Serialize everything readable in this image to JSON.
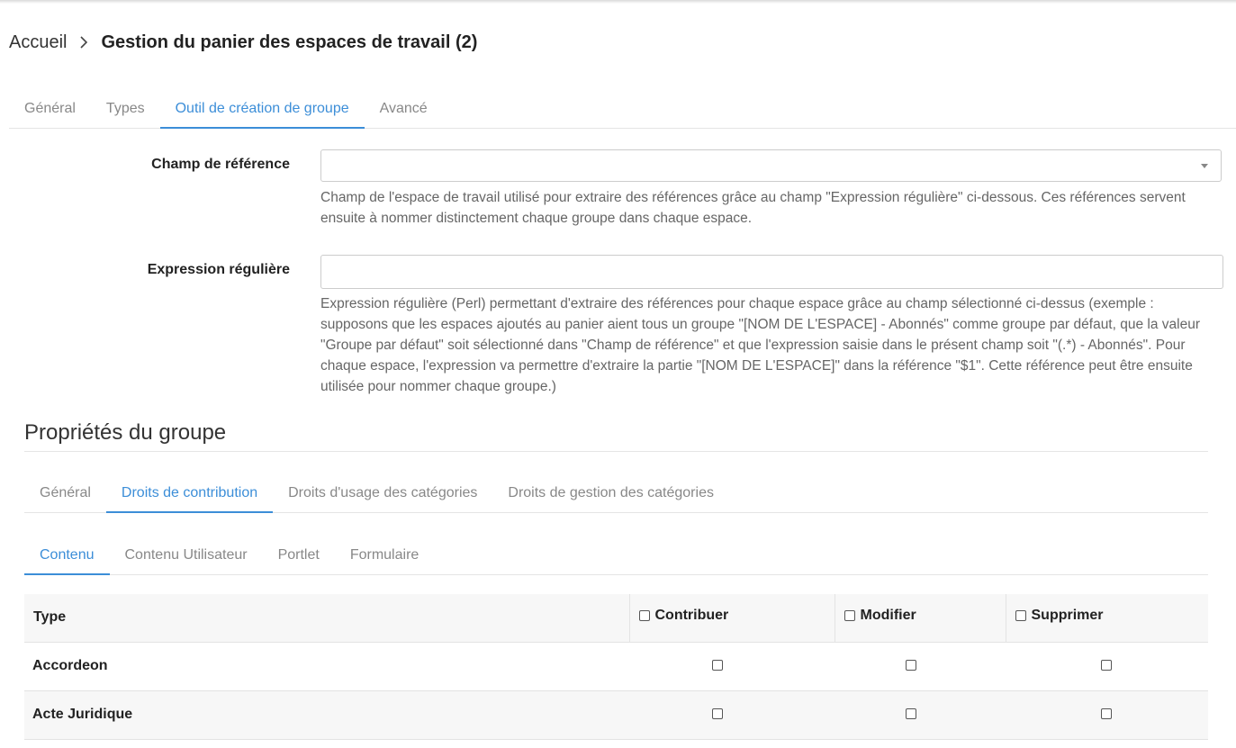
{
  "breadcrumb": {
    "home": "Accueil",
    "current": "Gestion du panier des espaces de travail (2)"
  },
  "main_tabs": [
    {
      "label": "Général",
      "active": false
    },
    {
      "label": "Types",
      "active": false
    },
    {
      "label": "Outil de création de groupe",
      "active": true
    },
    {
      "label": "Avancé",
      "active": false
    }
  ],
  "form": {
    "reference_field": {
      "label": "Champ de référence",
      "value": "",
      "help": "Champ de l'espace de travail utilisé pour extraire des références grâce au champ \"Expression régulière\" ci-dessous. Ces références servent ensuite à nommer distinctement chaque groupe dans chaque espace."
    },
    "regex_field": {
      "label": "Expression régulière",
      "value": "",
      "help": "Expression régulière (Perl) permettant d'extraire des références pour chaque espace grâce au champ sélectionné ci-dessus (exemple : supposons que les espaces ajoutés au panier aient tous un groupe \"[NOM DE L'ESPACE] - Abonnés\" comme groupe par défaut, que la valeur \"Groupe par défaut\" soit sélectionné dans \"Champ de référence\" et que l'expression saisie dans le présent champ soit \"(.*) - Abonnés\". Pour chaque espace, l'expression va permettre d'extraire la partie \"[NOM DE L'ESPACE]\" dans la référence \"$1\". Cette référence peut être ensuite utilisée pour nommer chaque groupe.)"
    }
  },
  "group_properties": {
    "title": "Propriétés du groupe",
    "tabs": [
      {
        "label": "Général",
        "active": false
      },
      {
        "label": "Droits de contribution",
        "active": true
      },
      {
        "label": "Droits d'usage des catégories",
        "active": false
      },
      {
        "label": "Droits de gestion des catégories",
        "active": false
      }
    ],
    "sub_tabs": [
      {
        "label": "Contenu",
        "active": true
      },
      {
        "label": "Contenu Utilisateur",
        "active": false
      },
      {
        "label": "Portlet",
        "active": false
      },
      {
        "label": "Formulaire",
        "active": false
      }
    ],
    "table": {
      "headers": {
        "type": "Type",
        "contribute": "Contribuer",
        "modify": "Modifier",
        "delete": "Supprimer"
      },
      "rows": [
        {
          "type": "Accordeon",
          "contribute": false,
          "modify": false,
          "delete": false
        },
        {
          "type": "Acte Juridique",
          "contribute": false,
          "modify": false,
          "delete": false
        }
      ]
    }
  },
  "icons": {
    "breadcrumb_separator": "chevron-right-icon",
    "select_caret": "caret-down-icon"
  }
}
